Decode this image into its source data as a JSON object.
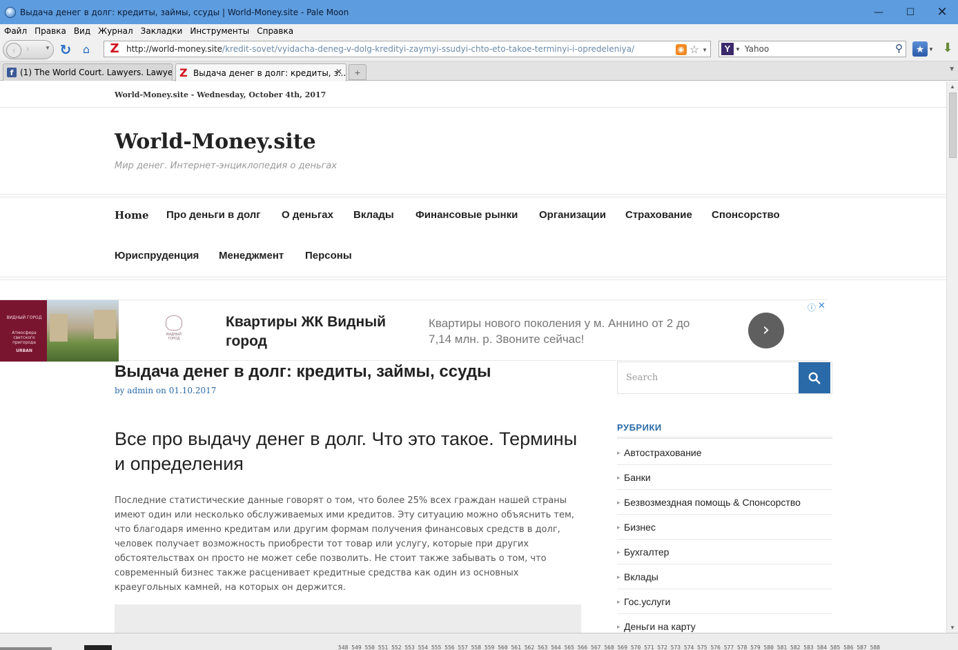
{
  "window": {
    "title": "Выдача денег в долг: кредиты, займы, ссуды | World-Money.site - Pale Moon",
    "minimize": "—",
    "maximize": "☐",
    "close": "✕"
  },
  "menu": [
    "Файл",
    "Правка",
    "Вид",
    "Журнал",
    "Закладки",
    "Инструменты",
    "Справка"
  ],
  "nav": {
    "url_host": "http://world-money.site",
    "url_path": "/kredit-sovet/vyidacha-deneg-v-dolg-kredityi-zaymyi-ssudyi-chto-eto-takoe-terminyi-i-opredeleniya/",
    "search_engine": "Yahoo"
  },
  "tabs": [
    {
      "label": "(1) The World Court. Lawyers. Lawye...",
      "favicon": "facebook-icon",
      "active": false
    },
    {
      "label": "Выдача денег в долг: кредиты, з...",
      "favicon": "z-icon",
      "active": true
    }
  ],
  "site": {
    "topline": "World-Money.site - Wednesday, October 4th, 2017",
    "title": "World-Money.site",
    "description": "Мир денег. Интернет-энциклопедия о деньгах",
    "menu": [
      "Home",
      "Про деньги в долг",
      "О деньгах",
      "Вклады",
      "Финансовые рынки",
      "Организации",
      "Страхование",
      "Спонсорство",
      "Юриспруденция",
      "Менеджмент",
      "Персоны"
    ]
  },
  "ad": {
    "image_caption": "ВИДНЫЙ ГОРОД",
    "image_tagline": "Атмосфера светского пригорода",
    "image_brand": "URBAN",
    "logo_caption": "ВИДНЫЙ ГОРОД",
    "headline": "Квартиры ЖК Видный город",
    "text": "Квартиры нового поколения у м. Аннино от 2 до 7,14 млн. р. Звоните сейчас!",
    "cta": "›",
    "info": "ⓘ",
    "close": "✕"
  },
  "article": {
    "title": "Выдача денег в долг: кредиты, займы, ссуды",
    "by": "by",
    "author": "admin",
    "on": "on",
    "date": "01.10.2017",
    "h2": "Все про выдачу денег в долг.  Что это такое. Термины и определения",
    "paragraph": "Последние статистические данные говорят о том, что более 25% всех граждан нашей страны имеют один или несколько обслуживаемых ими кредитов. Эту ситуацию можно объяснить тем, что благодаря именно кредитам или другим формам получения финансовых средств в долг, человек получает возможность приобрести тот товар или услугу, которые при других обстоятельствах он просто не может себе позволить. Не стоит также забывать о том, что современный бизнес также расценивает кредитные средства как один из основных краеугольных камней, на которых он держится."
  },
  "sidebar": {
    "search_placeholder": "Search",
    "heading": "РУБРИКИ",
    "categories": [
      "Автострахование",
      "Банки",
      "Безвозмездная помощь & Спонсорство",
      "Бизнес",
      "Бухгалтер",
      "Вклады",
      "Гос.услуги",
      "Деньги на карту"
    ]
  },
  "statusbar": {
    "numbers": "548 549 550 551 552 553 554 555 556 557 558 559 560 561 562 563 564 565 566 567 568 569 570 571 572 573 574 575 576 577 578 579 580 581 582 583 584 585 586 587 588"
  },
  "colors": {
    "titlebar": "#5d9cde",
    "link": "#2a6aa8",
    "ad_cta": "#5f5f5f"
  }
}
